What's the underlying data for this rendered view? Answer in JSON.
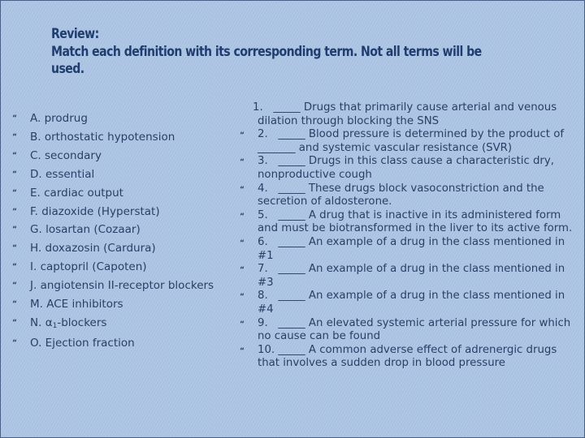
{
  "title": {
    "line1": "Review:",
    "line2": "Match each definition with its corresponding term. Not all terms will be",
    "line3": "used."
  },
  "bullet_icon": "quote-bullet",
  "terms": [
    {
      "letter": "A.",
      "text": "prodrug"
    },
    {
      "letter": "B.",
      "text": "orthostatic hypotension"
    },
    {
      "letter": "C.",
      "text": "secondary"
    },
    {
      "letter": "D.",
      "text": "essential"
    },
    {
      "letter": "E.",
      "text": "cardiac output"
    },
    {
      "letter": "F.",
      "text": "diazoxide (Hyperstat)"
    },
    {
      "letter": "G.",
      "text": "losartan (Cozaar)"
    },
    {
      "letter": "H.",
      "text": "doxazosin (Cardura)"
    },
    {
      "letter": "I.",
      "text": "captopril (Capoten)"
    },
    {
      "letter": "J.",
      "text": "angiotensin II-receptor blockers"
    },
    {
      "letter": "M.",
      "text": "ACE inhibitors"
    },
    {
      "letter": "N.",
      "text_prefix": "α",
      "text_sub": "1",
      "text": "-blockers"
    },
    {
      "letter": "O.",
      "text": "Ejection fraction"
    }
  ],
  "definitions": [
    {
      "num": "1.",
      "blank": "_____",
      "text": "Drugs that primarily cause arterial and venous dilation through blocking the SNS"
    },
    {
      "num": "2.",
      "blank": "_____",
      "text": "Blood pressure is determined by the product of _______ and systemic vascular resistance (SVR)"
    },
    {
      "num": "3.",
      "blank": "_____",
      "text": "Drugs in this class cause a characteristic dry, nonproductive cough"
    },
    {
      "num": "4.",
      "blank": "_____",
      "text": "These drugs block vasoconstriction and the secretion of aldosterone."
    },
    {
      "num": "5.",
      "blank": "_____",
      "text": "A drug that is inactive in its administered form and must be biotransformed in the liver to its active form."
    },
    {
      "num": "6.",
      "blank": "_____",
      "text": "An example of a drug in the class mentioned in #1"
    },
    {
      "num": "7.",
      "blank": "_____",
      "text": "An example of a drug in the class mentioned in #3"
    },
    {
      "num": "8.",
      "blank": "_____",
      "text": "An example of a drug in the class mentioned in #4"
    },
    {
      "num": "9.",
      "blank": "_____",
      "text": "An elevated systemic arterial pressure for which no cause can be found"
    },
    {
      "num": "10.",
      "blank": "_____",
      "text": "A common adverse effect of adrenergic drugs that involves a sudden drop in blood pressure"
    }
  ],
  "colors": {
    "background": "#aec7e6",
    "border": "#4a5f86",
    "title": "#1f3d6e",
    "body_text": "#2b3e66"
  }
}
